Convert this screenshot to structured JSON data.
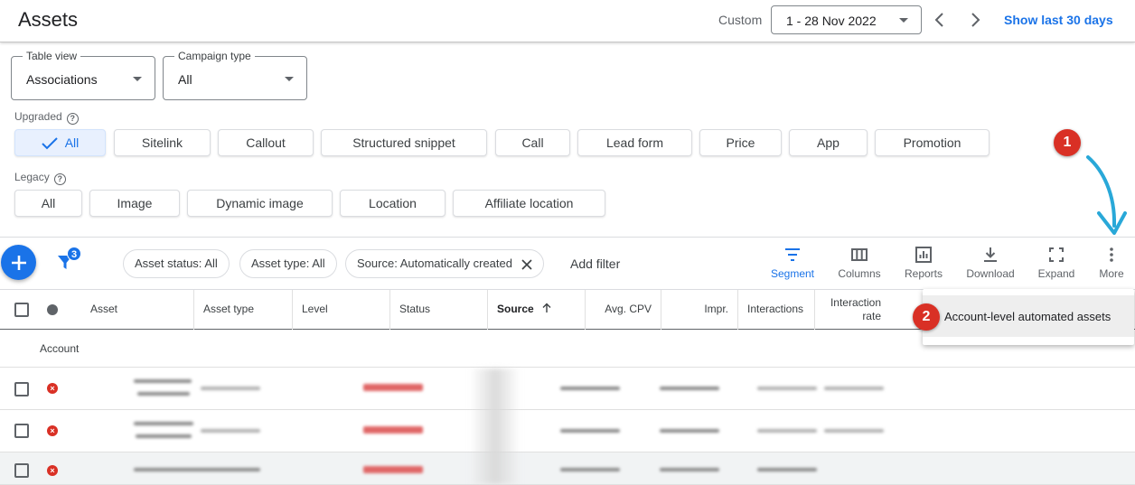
{
  "header": {
    "title": "Assets",
    "custom_label": "Custom",
    "date_range": "1 - 28 Nov 2022",
    "show_last": "Show last 30 days"
  },
  "filters": {
    "table_view": {
      "legend": "Table view",
      "value": "Associations"
    },
    "campaign_type": {
      "legend": "Campaign type",
      "value": "All"
    }
  },
  "upgraded": {
    "label": "Upgraded",
    "chips": [
      "All",
      "Sitelink",
      "Callout",
      "Structured snippet",
      "Call",
      "Lead form",
      "Price",
      "App",
      "Promotion"
    ]
  },
  "legacy": {
    "label": "Legacy",
    "chips": [
      "All",
      "Image",
      "Dynamic image",
      "Location",
      "Affiliate location"
    ]
  },
  "toolbar": {
    "filter_count": "3",
    "filter_chips": [
      "Asset status: All",
      "Asset type: All",
      "Source: Automatically created"
    ],
    "add_filter": "Add filter",
    "tools": [
      "Segment",
      "Columns",
      "Reports",
      "Download",
      "Expand",
      "More"
    ]
  },
  "table": {
    "columns": [
      "Asset",
      "Asset type",
      "Level",
      "Status",
      "Source",
      "Avg. CPV",
      "Impr.",
      "Interactions",
      "Interaction rate"
    ],
    "interaction_rate_line1": "Interaction",
    "interaction_rate_line2": "rate",
    "account_label": "Account"
  },
  "menu": {
    "item": "Account-level automated assets"
  },
  "annotations": {
    "step1": "1",
    "step2": "2"
  },
  "colors": {
    "accent": "#1a73e8",
    "annotation": "#d93025",
    "arrow": "#29a8d8"
  }
}
